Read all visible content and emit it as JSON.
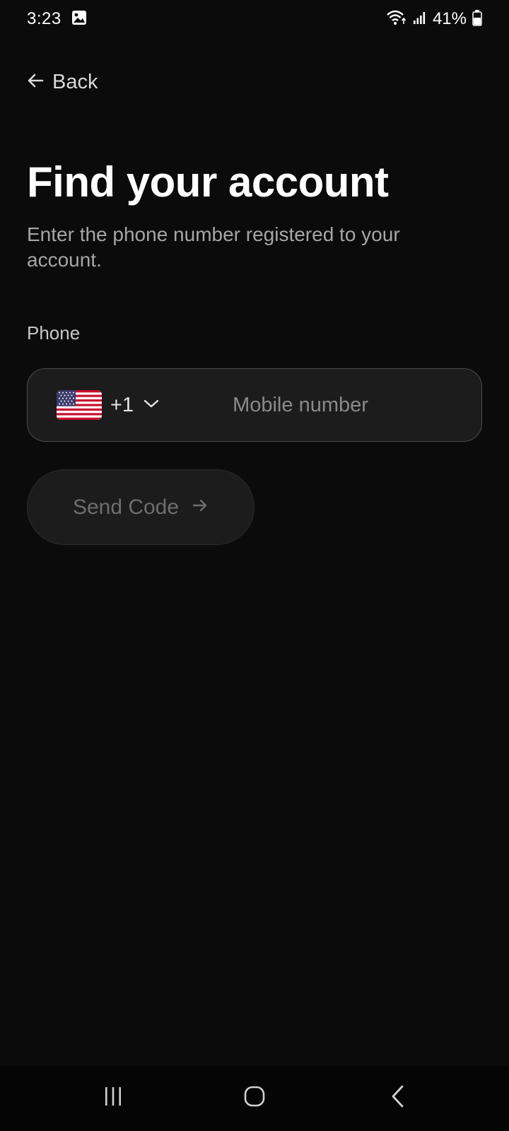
{
  "status_bar": {
    "time": "3:23",
    "battery_text": "41%",
    "icons": [
      "gallery-icon",
      "wifi-icon",
      "signal-icon",
      "battery-icon"
    ]
  },
  "header": {
    "back_label": "Back"
  },
  "main": {
    "title": "Find your account",
    "subtitle": "Enter the phone number registered to your account.",
    "phone_label": "Phone",
    "country_code": "+1",
    "country_flag": "us-flag-icon",
    "mobile_placeholder": "Mobile number",
    "mobile_value": "",
    "send_button_label": "Send Code"
  },
  "nav_bar": {
    "icons": [
      "recent-apps-icon",
      "home-icon",
      "back-icon"
    ]
  },
  "colors": {
    "background": "#0b0b0b",
    "input_background": "#1c1c1c",
    "input_border": "#4b4b4b",
    "disabled_text": "#6e6e6e",
    "subtitle_text": "#a6a6a6"
  }
}
